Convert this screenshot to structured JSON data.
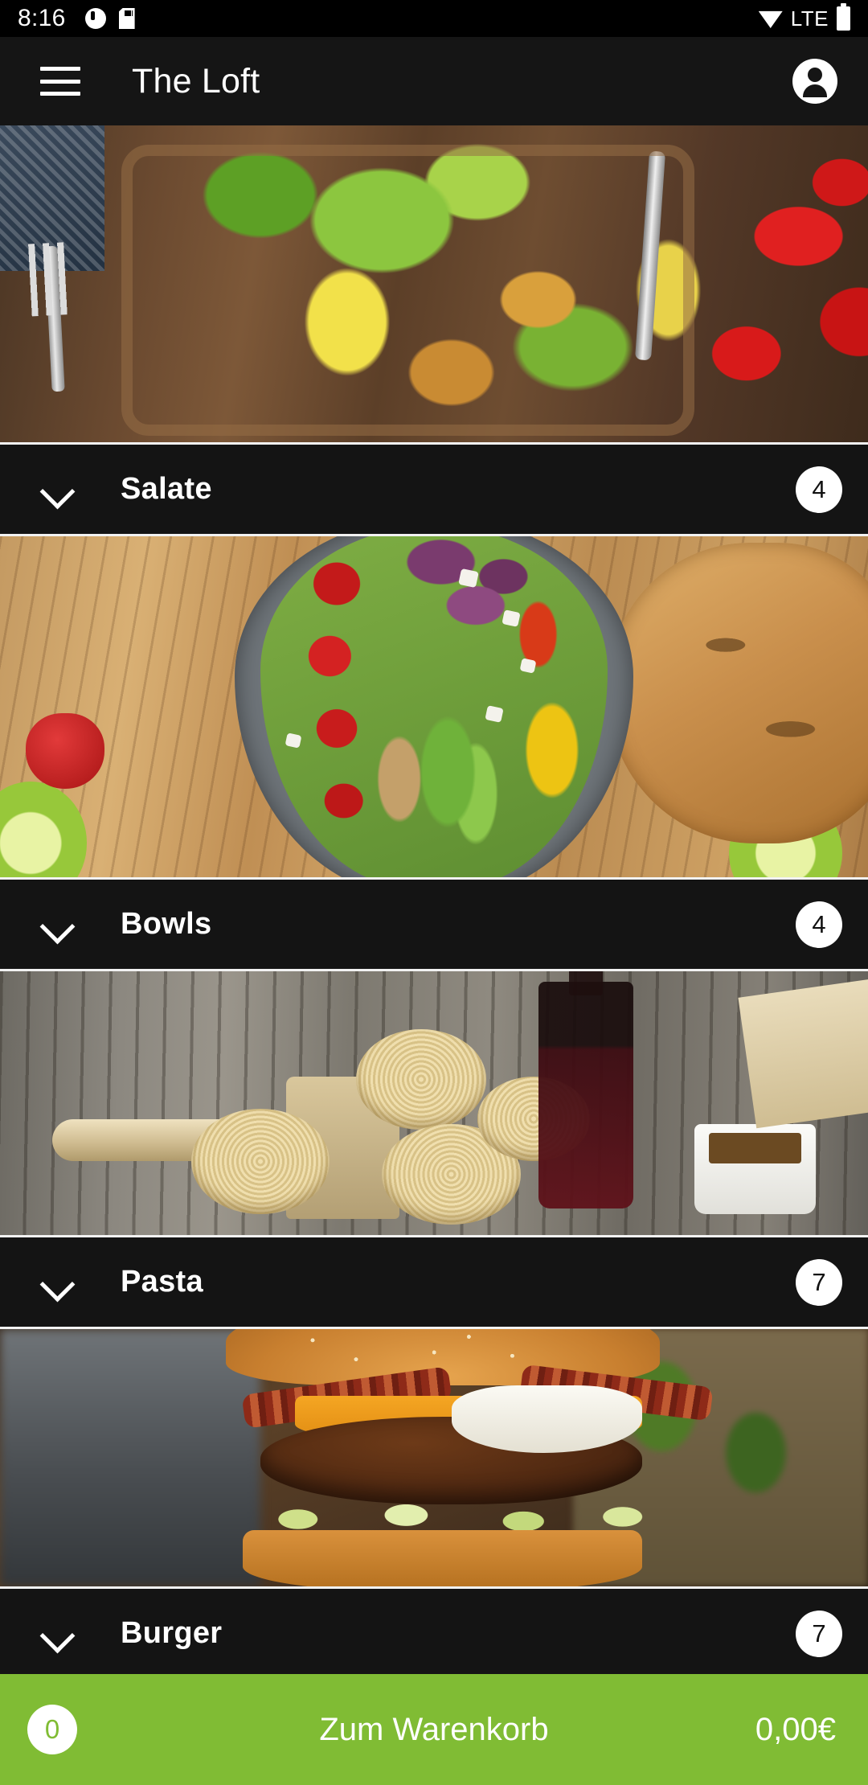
{
  "status_bar": {
    "time": "8:16",
    "network": "LTE",
    "icons": [
      "clock-icon",
      "sd-card-icon",
      "wifi-icon",
      "battery-icon"
    ]
  },
  "app_bar": {
    "menu_icon": "hamburger-menu-icon",
    "title": "The Loft",
    "account_icon": "account-avatar-icon"
  },
  "categories": [
    {
      "name": "Salate",
      "count": "4",
      "chevron": "chevron-down-icon",
      "image": "salad-photo"
    },
    {
      "name": "Bowls",
      "count": "4",
      "chevron": "chevron-down-icon",
      "image": "bowl-photo"
    },
    {
      "name": "Pasta",
      "count": "7",
      "chevron": "chevron-down-icon",
      "image": "pasta-photo"
    },
    {
      "name": "Burger",
      "count": "7",
      "chevron": "chevron-down-icon",
      "image": "burger-photo"
    }
  ],
  "cart_bar": {
    "item_count": "0",
    "label": "Zum Warenkorb",
    "total": "0,00€",
    "accent_color": "#80bc34"
  },
  "colors": {
    "status_bar_bg": "#000000",
    "app_bar_bg": "#151515",
    "row_bg": "#141414",
    "separator": "#f2f2f2",
    "badge_bg": "#ffffff",
    "text_on_dark": "#ffffff",
    "cart_green": "#80bc34"
  }
}
